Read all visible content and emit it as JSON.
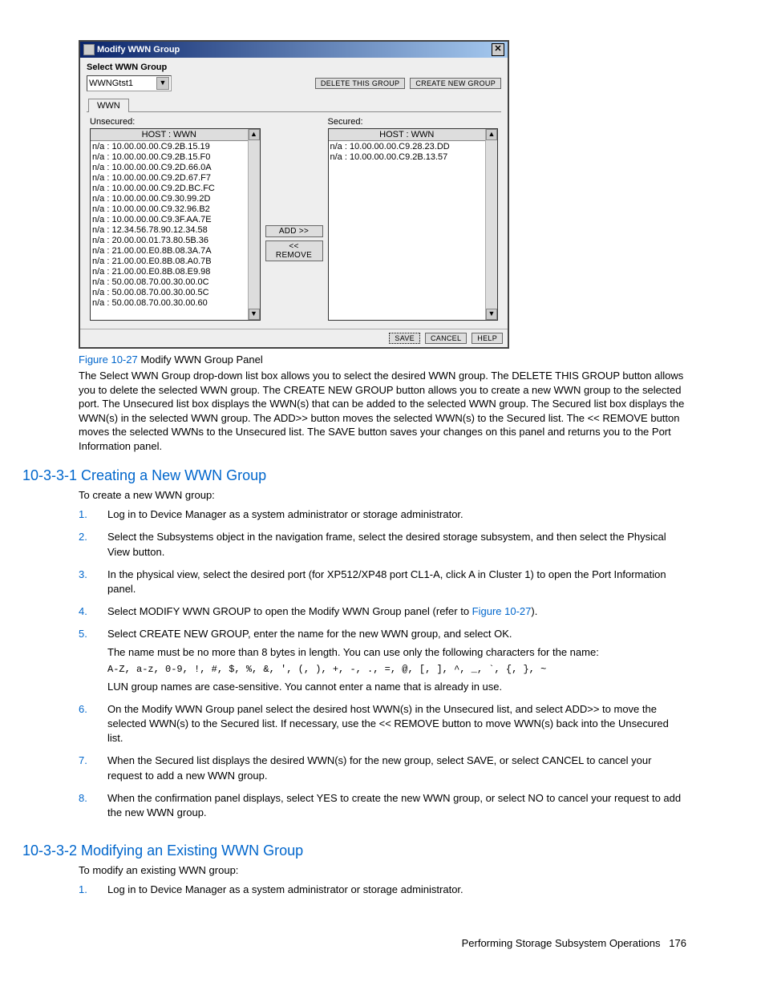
{
  "panel": {
    "title": "Modify WWN Group",
    "sectionLabel": "Select WWN Group",
    "dropdown": "WWNGtst1",
    "deleteGroup": "DELETE THIS GROUP",
    "createGroup": "CREATE NEW GROUP",
    "tab": "WWN",
    "unsecuredLabel": "Unsecured:",
    "securedLabel": "Secured:",
    "listHeader": "HOST : WWN",
    "add": "ADD >>",
    "remove": "<< REMOVE",
    "save": "SAVE",
    "cancel": "CANCEL",
    "help": "HELP",
    "unsecured": [
      "n/a : 10.00.00.00.C9.2B.15.19",
      "n/a : 10.00.00.00.C9.2B.15.F0",
      "n/a : 10.00.00.00.C9.2D.66.0A",
      "n/a : 10.00.00.00.C9.2D.67.F7",
      "n/a : 10.00.00.00.C9.2D.BC.FC",
      "n/a : 10.00.00.00.C9.30.99.2D",
      "n/a : 10.00.00.00.C9.32.96.B2",
      "n/a : 10.00.00.00.C9.3F.AA.7E",
      "n/a : 12.34.56.78.90.12.34.58",
      "n/a : 20.00.00.01.73.80.5B.36",
      "n/a : 21.00.00.E0.8B.08.3A.7A",
      "n/a : 21.00.00.E0.8B.08.A0.7B",
      "n/a : 21.00.00.E0.8B.08.E9.98",
      "n/a : 50.00.08.70.00.30.00.0C",
      "n/a : 50.00.08.70.00.30.00.5C",
      "n/a : 50.00.08.70.00.30.00.60"
    ],
    "secured": [
      "n/a : 10.00.00.00.C9.28.23.DD",
      "n/a : 10.00.00.00.C9.2B.13.57"
    ]
  },
  "caption": {
    "figRef": "Figure 10-27",
    "text": " Modify WWN Group Panel"
  },
  "descPara": "The Select WWN Group drop-down list box allows you to select the desired WWN group. The DELETE THIS GROUP button allows you to delete the selected WWN group. The CREATE NEW GROUP button allows you to create a new WWN group to the selected port. The Unsecured list box displays the WWN(s) that can be added to the selected WWN group. The Secured list box displays the WWN(s) in the selected WWN group. The ADD>> button moves the selected WWN(s) to the Secured list. The << REMOVE button moves the selected WWNs to the Unsecured list. The SAVE button saves your changes on this panel and returns you to the Port Information panel.",
  "sec1": {
    "title": "10-3-3-1 Creating a New WWN Group",
    "intro": "To create a new WWN group:",
    "steps": [
      {
        "text": "Log in to Device Manager as a system administrator or storage administrator."
      },
      {
        "text": "Select the Subsystems object in the navigation frame, select the desired storage subsystem, and then select the Physical View button."
      },
      {
        "text": "In the physical view, select the desired port (for XP512/XP48 port CL1-A, click A in Cluster 1) to open the Port Information panel."
      },
      {
        "pre": "Select MODIFY WWN GROUP to open the Modify WWN Group panel (refer to ",
        "link": "Figure 10-27",
        "post": ")."
      },
      {
        "text": "Select CREATE NEW GROUP, enter the name for the new WWN group, and select OK.",
        "sub1": "The name must be no more than 8 bytes in length. You can use only the following characters for the name:",
        "mono": "A-Z, a-z, 0-9, !, #, $, %, &, ', (, ), +, -, ., =, @, [, ], ^, _, `, {, }, ~",
        "sub2": "LUN group names are case-sensitive. You cannot enter a name that is already in use."
      },
      {
        "text": "On the Modify WWN Group panel select the desired host WWN(s) in the Unsecured list, and select ADD>> to move the selected WWN(s) to the Secured list. If necessary, use the << REMOVE button to move WWN(s) back into the Unsecured list."
      },
      {
        "text": "When the Secured list displays the desired WWN(s) for the new group, select SAVE, or select CANCEL to cancel your request to add a new WWN group."
      },
      {
        "text": "When the confirmation panel displays, select YES to create the new WWN group, or select NO to cancel your request to add the new WWN group."
      }
    ]
  },
  "sec2": {
    "title": "10-3-3-2 Modifying an Existing WWN Group",
    "intro": "To modify an existing WWN group:",
    "steps": [
      {
        "text": "Log in to Device Manager as a system administrator or storage administrator."
      }
    ]
  },
  "footer": {
    "text": "Performing Storage Subsystem Operations",
    "page": "176"
  }
}
